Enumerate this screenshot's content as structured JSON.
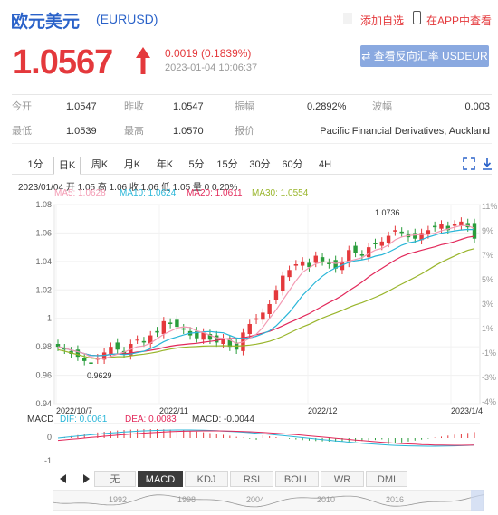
{
  "header": {
    "title": "欧元美元",
    "code": "(EURUSD)",
    "favorite": "添加自选",
    "app_link": "在APP中查看"
  },
  "quote": {
    "price": "1.0567",
    "change": "0.0019 (0.1839%)",
    "time": "2023-01-04 10:06:37",
    "reverse_button": "查看反向汇率 USDEUR",
    "up_color": "#e4393c",
    "down_color": "#2a9d3c"
  },
  "stats": {
    "row1": [
      {
        "label": "今开",
        "value": "1.0547"
      },
      {
        "label": "昨收",
        "value": "1.0547"
      },
      {
        "label": "振幅",
        "value": "0.2892%"
      },
      {
        "label": "波幅",
        "value": "0.003"
      }
    ],
    "row2": [
      {
        "label": "最低",
        "value": "1.0539"
      },
      {
        "label": "最高",
        "value": "1.0570"
      },
      {
        "label": "报价",
        "value": "Pacific Financial Derivatives, Auckland"
      }
    ]
  },
  "toolbar": {
    "tabs": [
      "1分",
      "日K",
      "周K",
      "月K",
      "年K",
      "5分",
      "15分",
      "30分",
      "60分",
      "4H"
    ],
    "active_tab": "日K"
  },
  "ohlc_info": "2023/01/04 开 1.05 高 1.06 收 1.06 低 1.05 量 0 0.20%",
  "ma_labels": {
    "ma5": "MA5: 1.0628",
    "ma10": "MA10: 1.0624",
    "ma20": "MA20: 1.0611",
    "ma30": "MA30: 1.0554"
  },
  "ma_colors": {
    "ma5": "#f39ab3",
    "ma10": "#29b6d8",
    "ma20": "#e2285a",
    "ma30": "#99b52b"
  },
  "chart_data": {
    "type": "candlestick",
    "y_left_ticks": [
      "1.08",
      "1.06",
      "1.04",
      "1.02",
      "1",
      "0.98",
      "0.96",
      "0.94"
    ],
    "y_right_ticks": [
      "11%",
      "9%",
      "7%",
      "5%",
      "3%",
      "1%",
      "-1%",
      "-3%",
      "-4%"
    ],
    "x_labels": [
      "2022/10/7",
      "2022/11",
      "2022/12",
      "2023/1/4"
    ],
    "ylim": [
      0.94,
      1.08
    ],
    "annotations": {
      "high": "1.0736",
      "low": "0.9629"
    }
  },
  "macd": {
    "label": "MACD",
    "dif": "DIF: 0.0061",
    "dea": "DEA: 0.0083",
    "macd": "MACD: -0.0044",
    "y_ticks": [
      "0",
      "-1"
    ]
  },
  "bottom_tabs": [
    "无",
    "MACD",
    "KDJ",
    "RSI",
    "BOLL",
    "WR",
    "DMI"
  ],
  "active_bottom_tab": "MACD",
  "timeline_years": [
    "1992",
    "1998",
    "2004",
    "2010",
    "2016"
  ]
}
